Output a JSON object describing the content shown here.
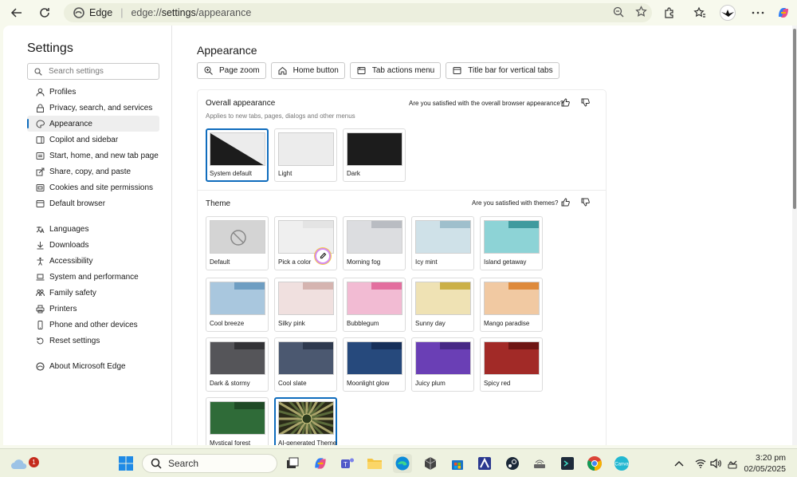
{
  "browser": {
    "edge_label": "Edge",
    "url_prefix": "edge://",
    "url_bold": "settings",
    "url_suffix": "/appearance"
  },
  "sidebar": {
    "title": "Settings",
    "search_placeholder": "Search settings",
    "items": [
      {
        "label": "Profiles",
        "icon": "profile-icon"
      },
      {
        "label": "Privacy, search, and services",
        "icon": "lock-icon"
      },
      {
        "label": "Appearance",
        "icon": "palette-icon",
        "active": true
      },
      {
        "label": "Copilot and sidebar",
        "icon": "sidebar-icon"
      },
      {
        "label": "Start, home, and new tab page",
        "icon": "home-icon"
      },
      {
        "label": "Share, copy, and paste",
        "icon": "share-icon"
      },
      {
        "label": "Cookies and site permissions",
        "icon": "cookie-icon"
      },
      {
        "label": "Default browser",
        "icon": "browser-icon"
      },
      {
        "label": "Languages",
        "icon": "language-icon"
      },
      {
        "label": "Downloads",
        "icon": "download-icon"
      },
      {
        "label": "Accessibility",
        "icon": "accessibility-icon"
      },
      {
        "label": "System and performance",
        "icon": "laptop-icon"
      },
      {
        "label": "Family safety",
        "icon": "family-icon"
      },
      {
        "label": "Printers",
        "icon": "printer-icon"
      },
      {
        "label": "Phone and other devices",
        "icon": "phone-icon"
      },
      {
        "label": "Reset settings",
        "icon": "reset-icon"
      },
      {
        "label": "About Microsoft Edge",
        "icon": "edge-icon"
      }
    ]
  },
  "main": {
    "title": "Appearance",
    "tabs": [
      "Page zoom",
      "Home button",
      "Tab actions menu",
      "Title bar for vertical tabs"
    ],
    "overall": {
      "title": "Overall appearance",
      "subtitle": "Applies to new tabs, pages, dialogs and other menus",
      "feedback": "Are you satisfied with the overall browser appearance?",
      "options": [
        {
          "label": "System default",
          "selected": true
        },
        {
          "label": "Light"
        },
        {
          "label": "Dark"
        }
      ]
    },
    "theme": {
      "title": "Theme",
      "feedback": "Are you satisfied with themes?",
      "items": [
        {
          "label": "Default",
          "body": "#d4d4d4",
          "strip": "#d4d4d4",
          "tab": "#d4d4d4"
        },
        {
          "label": "Pick a color",
          "body": "#efefef",
          "strip": "#e4e4e4",
          "tab": "#efefef"
        },
        {
          "label": "Morning fog",
          "body": "#dcdde0",
          "strip": "#b9bcc2",
          "tab": "#dcdde0"
        },
        {
          "label": "Icy mint",
          "body": "#cfe1e8",
          "strip": "#9fbfcc",
          "tab": "#cfe1e8"
        },
        {
          "label": "Island getaway",
          "body": "#8dd3d6",
          "strip": "#3f9a9e",
          "tab": "#8dd3d6"
        },
        {
          "label": "Cool breeze",
          "body": "#a9c7de",
          "strip": "#6f9ec2",
          "tab": "#a9c7de"
        },
        {
          "label": "Silky pink",
          "body": "#f0e0df",
          "strip": "#d5b4b0",
          "tab": "#f0e0df"
        },
        {
          "label": "Bubblegum",
          "body": "#f2bbd3",
          "strip": "#e36f9f",
          "tab": "#f2bbd3"
        },
        {
          "label": "Sunny day",
          "body": "#efe2b4",
          "strip": "#cbb048",
          "tab": "#efe2b4"
        },
        {
          "label": "Mango paradise",
          "body": "#f1c9a2",
          "strip": "#de8a3c",
          "tab": "#f1c9a2"
        },
        {
          "label": "Dark & stormy",
          "body": "#555559",
          "strip": "#333336",
          "tab": "#555559"
        },
        {
          "label": "Cool slate",
          "body": "#4b5870",
          "strip": "#2f3a4f",
          "tab": "#4b5870"
        },
        {
          "label": "Moonlight glow",
          "body": "#26497c",
          "strip": "#17305a",
          "tab": "#26497c"
        },
        {
          "label": "Juicy plum",
          "body": "#6a3fb5",
          "strip": "#472985",
          "tab": "#6a3fb5"
        },
        {
          "label": "Spicy red",
          "body": "#a22a27",
          "strip": "#6e1614",
          "tab": "#a22a27"
        },
        {
          "label": "Mystical forest",
          "body": "#2f6b38",
          "strip": "#1f4a26",
          "tab": "#2f6b38"
        },
        {
          "label": "AI-generated Theme",
          "body": "#3a3a20",
          "strip": "#1b1b10",
          "tab": "#3a3a20",
          "selected": true
        }
      ]
    }
  },
  "taskbar": {
    "search_label": "Search",
    "weather_badge": "1",
    "time": "3:20 pm",
    "date": "02/05/2025"
  }
}
